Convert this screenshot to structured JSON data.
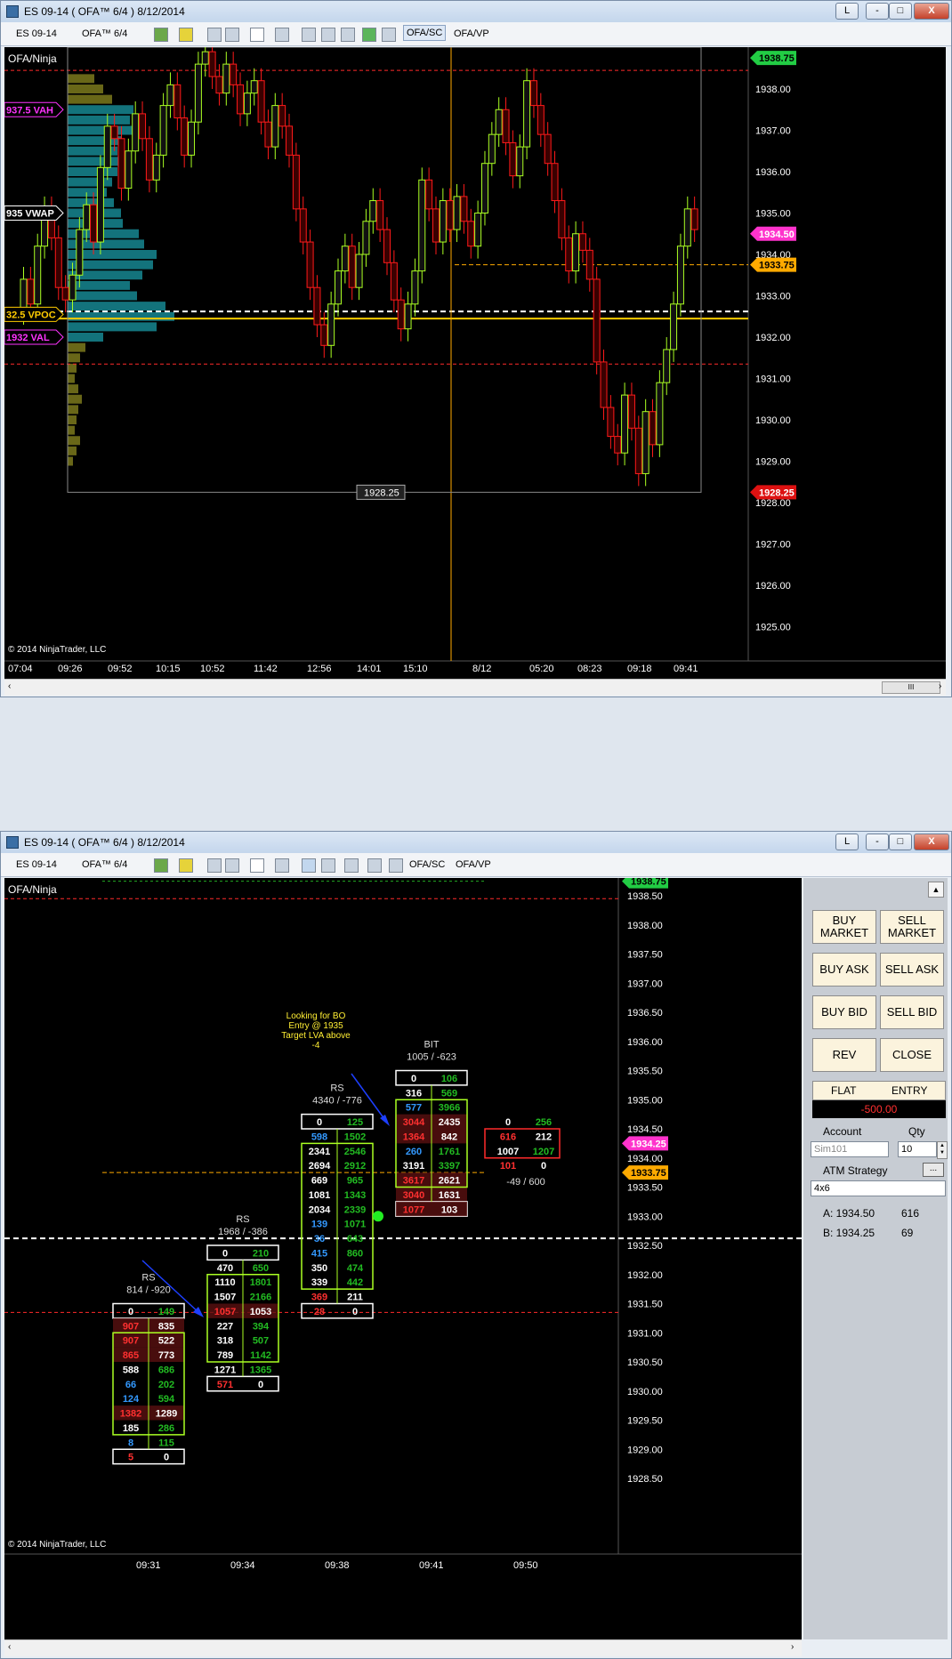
{
  "window1": {
    "title": "ES 09-14 ( OFA™ 6/4 )  8/12/2014",
    "controls": [
      "L",
      "-",
      "□",
      "X"
    ],
    "toolbar": {
      "instrument": "ES 09-14",
      "period": "OFA™ 6/4",
      "tab1": "OFA/SC",
      "tab2": "OFA/VP"
    }
  },
  "window2": {
    "title": "ES 09-14 ( OFA™ 6/4 )  8/12/2014",
    "controls": [
      "L",
      "-",
      "□",
      "X"
    ],
    "toolbar": {
      "instrument": "ES 09-14",
      "period": "OFA™ 6/4",
      "tab1": "OFA/SC",
      "tab2": "OFA/VP"
    }
  },
  "top_chart": {
    "indicator_label": "OFA/Ninja",
    "copyright": "© 2014 NinjaTrader, LLC",
    "y_ticks": [
      "1938.00",
      "1937.00",
      "1936.00",
      "1935.00",
      "1934.00",
      "1933.00",
      "1932.00",
      "1931.00",
      "1930.00",
      "1929.00",
      "1928.00",
      "1927.00",
      "1926.00",
      "1925.00"
    ],
    "x_ticks": [
      "07:04",
      "09:26",
      "09:52",
      "10:15",
      "10:52",
      "11:42",
      "12:56",
      "14:01",
      "15:10",
      "8/12",
      "05:20",
      "08:23",
      "09:18",
      "09:41"
    ],
    "labels": {
      "vah": "937.5 VAH",
      "vwap": "935 VWAP",
      "poc": "32.5 VPOC",
      "val": "1932 VAL",
      "low_box": "1928.25"
    },
    "price_badges": {
      "high": "1938.75",
      "last": "1934.50",
      "level": "1933.75",
      "low": "1928.25"
    },
    "scroll_glyph": "III"
  },
  "bottom_chart": {
    "indicator_label": "OFA/Ninja",
    "copyright": "© 2014 NinjaTrader, LLC",
    "y_ticks": [
      "1938.50",
      "1938.00",
      "1937.50",
      "1937.00",
      "1936.50",
      "1936.00",
      "1935.50",
      "1935.00",
      "1934.50",
      "1934.00",
      "1933.50",
      "1933.00",
      "1932.50",
      "1932.00",
      "1931.50",
      "1931.00",
      "1930.50",
      "1930.00",
      "1929.50",
      "1929.00",
      "1928.50"
    ],
    "x_ticks": [
      "09:31",
      "09:34",
      "09:38",
      "09:41",
      "09:50"
    ],
    "price_badges": {
      "high": "1938.75",
      "bid": "1934.25",
      "level": "1933.75"
    },
    "annotation": [
      "Looking for BO",
      "Entry @ 1935",
      "Target LVA above",
      "-4"
    ],
    "bars": [
      {
        "title": "RS",
        "sub": "814 / -920",
        "rows": [
          [
            "0",
            "149"
          ],
          [
            "907",
            "835"
          ],
          [
            "907",
            "522"
          ],
          [
            "865",
            "773"
          ],
          [
            "588",
            "686"
          ],
          [
            "66",
            "202"
          ],
          [
            "124",
            "594"
          ],
          [
            "1382",
            "1289"
          ],
          [
            "185",
            "286"
          ],
          [
            "8",
            "115"
          ],
          [
            "5",
            "0"
          ]
        ]
      },
      {
        "title": "RS",
        "sub": "1968 / -386",
        "rows": [
          [
            "0",
            "210"
          ],
          [
            "470",
            "650"
          ],
          [
            "1110",
            "1801"
          ],
          [
            "1507",
            "2166"
          ],
          [
            "1057",
            "1053"
          ],
          [
            "227",
            "394"
          ],
          [
            "318",
            "507"
          ],
          [
            "789",
            "1142"
          ],
          [
            "1271",
            "1365"
          ],
          [
            "571",
            "0"
          ]
        ]
      },
      {
        "title": "RS",
        "sub": "4340 / -776",
        "rows": [
          [
            "0",
            "125"
          ],
          [
            "598",
            "1502"
          ],
          [
            "2341",
            "2546"
          ],
          [
            "2694",
            "2912"
          ],
          [
            "669",
            "965"
          ],
          [
            "1081",
            "1343"
          ],
          [
            "2034",
            "2339"
          ],
          [
            "139",
            "1071"
          ],
          [
            "36",
            "643"
          ],
          [
            "415",
            "860"
          ],
          [
            "350",
            "474"
          ],
          [
            "339",
            "442"
          ],
          [
            "369",
            "211"
          ],
          [
            "28",
            "0"
          ]
        ]
      },
      {
        "title": "BIT",
        "sub": "1005 / -623",
        "rows": [
          [
            "0",
            "106"
          ],
          [
            "316",
            "569"
          ],
          [
            "577",
            "3966"
          ],
          [
            "3044",
            "2435"
          ],
          [
            "1364",
            "842"
          ],
          [
            "260",
            "1761"
          ],
          [
            "3191",
            "3397"
          ],
          [
            "3617",
            "2621"
          ],
          [
            "3040",
            "1631"
          ],
          [
            "1077",
            "103"
          ]
        ]
      },
      {
        "title": "",
        "sub": "-49 / 600",
        "rows": [
          [
            "0",
            "256"
          ],
          [
            "616",
            "212"
          ],
          [
            "1007",
            "1207"
          ],
          [
            "101",
            "0"
          ]
        ]
      }
    ]
  },
  "order_panel": {
    "buttons": {
      "buy_market": "BUY MARKET",
      "sell_market": "SELL MARKET",
      "buy_ask": "BUY ASK",
      "sell_ask": "SELL ASK",
      "buy_bid": "BUY BID",
      "sell_bid": "SELL BID",
      "rev": "REV",
      "close": "CLOSE"
    },
    "position": {
      "flat": "FLAT",
      "entry": "ENTRY",
      "pnl": "-500.00"
    },
    "account_label": "Account",
    "qty_label": "Qty",
    "account": "Sim101",
    "qty": "10",
    "atm_label": "ATM Strategy",
    "atm_btn": "...",
    "atm_value": "4x6",
    "ask": "A: 1934.50",
    "ask_size": "616",
    "bid": "B: 1934.25",
    "bid_size": "69"
  },
  "colors": {
    "up": "#aaff22",
    "down": "#ff1a1a",
    "profile": "#1a9aa6",
    "profile_out": "#8c8a20",
    "vah": "#ff33ff",
    "badge_last": "#ff33cc",
    "badge_level": "#ffaa00",
    "badge_high": "#22cc44"
  }
}
